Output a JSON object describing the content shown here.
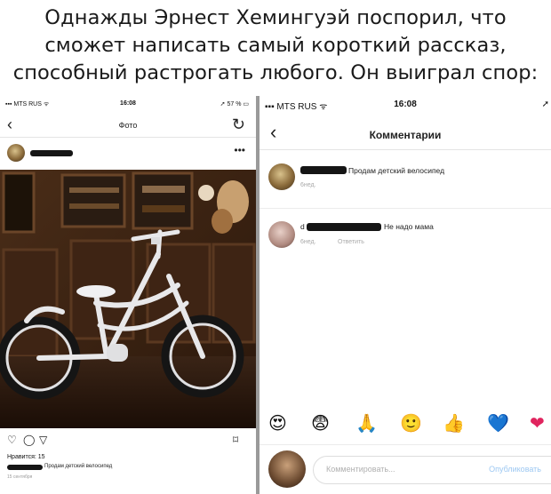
{
  "headline": {
    "line1": "Однажды Эрнест Хемингуэй поспорил, что",
    "line2": "сможет написать самый короткий рассказ,",
    "line3": "способный растрогать любого. Он выиграл спор:"
  },
  "left_screen": {
    "status": {
      "carrier": "MTS RUS",
      "time": "16:08",
      "battery": "57 %"
    },
    "nav_title": "Фото",
    "likes": "Нравится: 15",
    "caption": "Продам детский велосипед",
    "timestamp": "15 сентября"
  },
  "right_screen": {
    "status": {
      "carrier": "MTS RUS",
      "time": "16:08"
    },
    "nav_title": "Комментарии",
    "comments": [
      {
        "text": "Продам детский велосипед",
        "time": "6нед."
      },
      {
        "prefix": "d",
        "text": "Не надо мама",
        "time": "6нед.",
        "reply": "Ответить"
      }
    ],
    "emoji": [
      "😍",
      "😨",
      "🙏",
      "🙂",
      "👍",
      "💙",
      "❤"
    ],
    "input_placeholder": "Комментировать...",
    "post_label": "Опубликовать"
  }
}
